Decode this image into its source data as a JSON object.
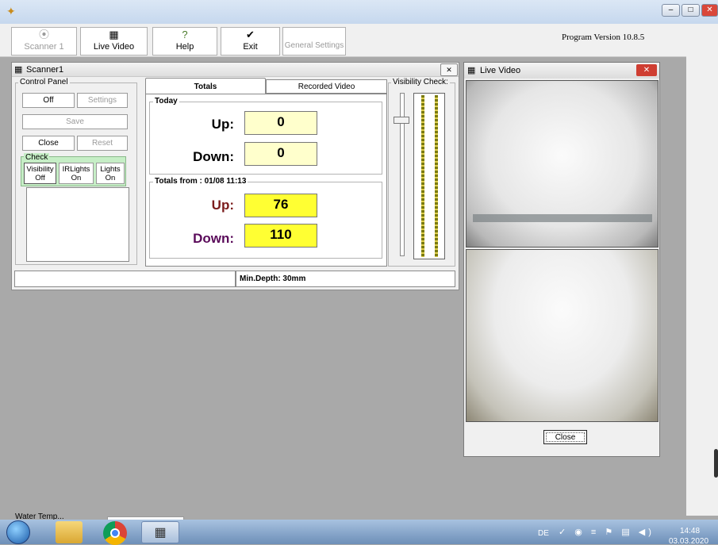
{
  "app": {
    "version_text": "Program Version 10.8.5"
  },
  "window_controls": {
    "minimize": "–",
    "maximize": "□",
    "close": "✕"
  },
  "toolbar": {
    "buttons": [
      {
        "label": "Scanner 1",
        "icon": "scanner-icon",
        "glyph": "⦿",
        "enabled": false
      },
      {
        "label": "Live Video",
        "icon": "film-icon",
        "glyph": "▦",
        "enabled": true
      },
      {
        "label": "Help",
        "icon": "help-icon",
        "glyph": "?",
        "enabled": true
      },
      {
        "label": "Exit",
        "icon": "checkmark-icon",
        "glyph": "✔",
        "enabled": true
      },
      {
        "label": "General Settings",
        "icon": "",
        "glyph": "",
        "enabled": false
      }
    ]
  },
  "scanner_window": {
    "title": "Scanner1",
    "close_glyph": "✕",
    "control_panel": {
      "title": "Control Panel",
      "off_label": "Off",
      "settings_label": "Settings",
      "save_label": "Save",
      "close_label": "Close",
      "reset_label": "Reset",
      "check": {
        "title": "Check",
        "visibility_label": "Visibility",
        "visibility_state": "Off",
        "irlights_label": "IRLights",
        "irlights_state": "On",
        "lights_label": "Lights",
        "lights_state": "On"
      }
    },
    "tabs": [
      {
        "label": "Totals",
        "active": true
      },
      {
        "label": "Recorded Video",
        "active": false
      }
    ],
    "today": {
      "title": "Today",
      "up_label": "Up:",
      "up_value": "0",
      "down_label": "Down:",
      "down_value": "0"
    },
    "totals_from": {
      "title": "Totals from : 01/08 11:13",
      "up_label": "Up:",
      "up_value": "76",
      "down_label": "Down:",
      "down_value": "110"
    },
    "visibility_check": {
      "title": "Visibility Check:"
    },
    "status": {
      "min_depth": "Min.Depth: 30mm"
    }
  },
  "live_video": {
    "title": "Live Video",
    "close_glyph": "✕",
    "close_button": "Close"
  },
  "partial_label": "Water Temp...",
  "taskbar": {
    "lang": "DE",
    "time": "14:48",
    "date": "03.03.2020",
    "icons": [
      "start-icon",
      "explorer-icon",
      "chrome-icon",
      "film-icon"
    ]
  },
  "colors": {
    "today_value_bg": "#ffffcc",
    "totals_value_bg": "#ffff33",
    "up_label_color": "#7b1c1c",
    "down_label_color": "#5a0b5a"
  }
}
